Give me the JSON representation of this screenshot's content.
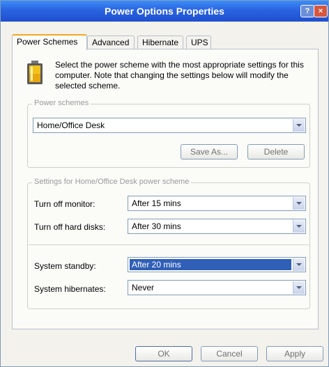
{
  "window": {
    "title": "Power Options Properties"
  },
  "tabs": [
    {
      "label": "Power Schemes",
      "active": true
    },
    {
      "label": "Advanced"
    },
    {
      "label": "Hibernate"
    },
    {
      "label": "UPS"
    }
  ],
  "intro_text": "Select the power scheme with the most appropriate settings for this computer. Note that changing the settings below will modify the selected scheme.",
  "power_schemes": {
    "legend": "Power schemes",
    "selected": "Home/Office Desk",
    "save_as_label": "Save As...",
    "delete_label": "Delete"
  },
  "settings": {
    "legend": "Settings for Home/Office Desk power scheme",
    "monitor_label": "Turn off monitor:",
    "monitor_value": "After 15 mins",
    "hard_disks_label": "Turn off hard disks:",
    "hard_disks_value": "After 30 mins",
    "standby_label": "System standby:",
    "standby_value": "After 20 mins",
    "hibernate_label": "System hibernates:",
    "hibernate_value": "Never"
  },
  "footer": {
    "ok_label": "OK",
    "cancel_label": "Cancel",
    "apply_label": "Apply"
  },
  "colors": {
    "titlebar": "#2a63e0",
    "selection": "#2f5fb7",
    "tab_accent": "#f5a623"
  }
}
